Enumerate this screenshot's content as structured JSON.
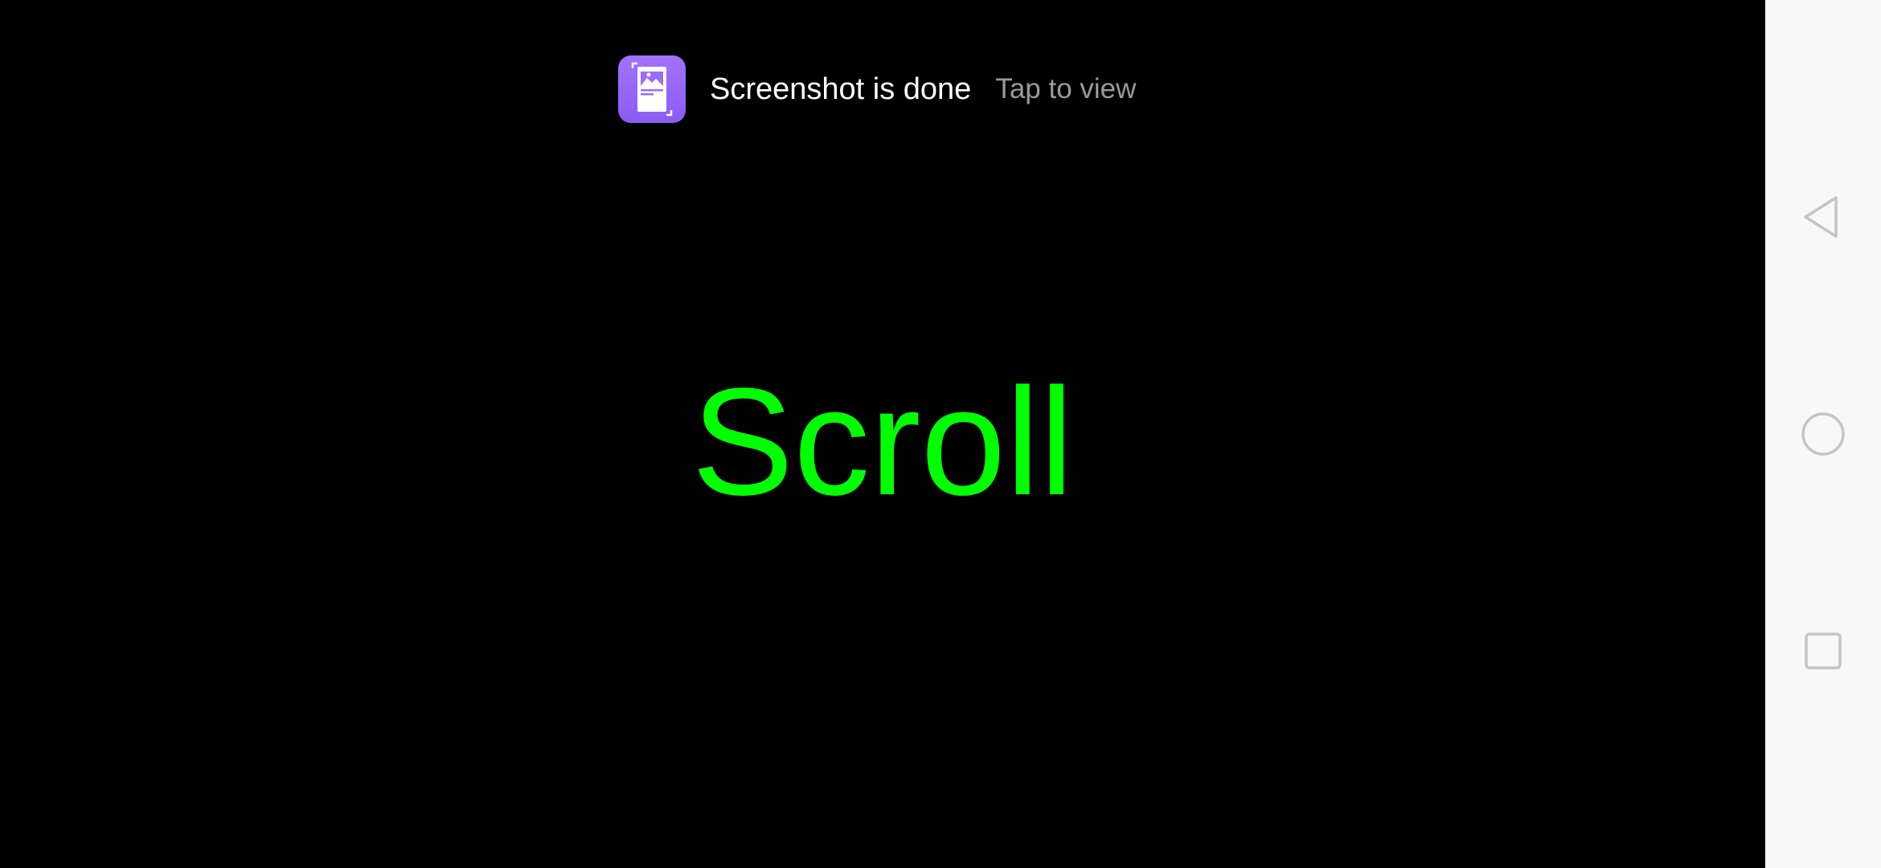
{
  "toast": {
    "icon": "screenshot-gallery-icon",
    "title": "Screenshot is done",
    "action": "Tap to view",
    "icon_color": "#9b6cf8"
  },
  "main": {
    "label": "Scroll",
    "label_color": "#00ff00",
    "background": "#000000"
  },
  "navbar": {
    "background": "#f8f8f8",
    "buttons": [
      {
        "icon": "back-triangle-icon"
      },
      {
        "icon": "home-circle-icon"
      },
      {
        "icon": "recents-square-icon"
      }
    ]
  }
}
